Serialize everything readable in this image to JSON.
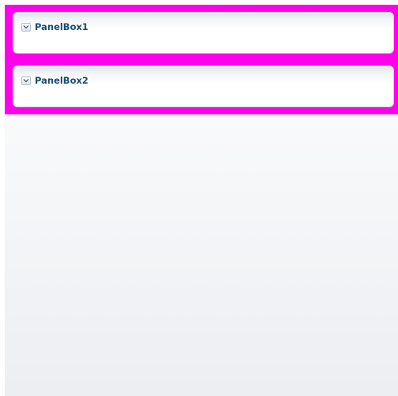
{
  "panels": [
    {
      "title": "PanelBox1",
      "expanded": true
    },
    {
      "title": "PanelBox2",
      "expanded": true
    }
  ],
  "colors": {
    "container_background": "#ff00ea",
    "title_text": "#1b4d6e",
    "panel_border": "#c9d0da"
  },
  "icons": {
    "disclosure": "chevron-down-icon"
  }
}
